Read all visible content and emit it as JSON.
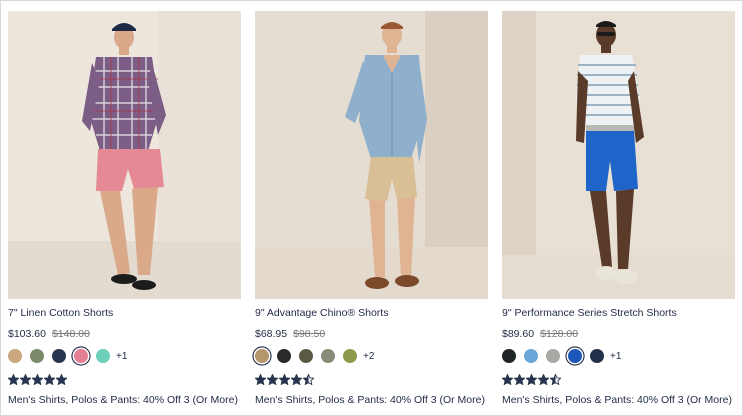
{
  "products": [
    {
      "title": "7\" Linen Cotton Shorts",
      "sale_price": "$103.60",
      "original_price": "$148.00",
      "swatches": [
        {
          "color": "#caa77c",
          "selected": false
        },
        {
          "color": "#7d8a6a",
          "selected": false
        },
        {
          "color": "#27344d",
          "selected": false
        },
        {
          "color": "#e27f93",
          "selected": true
        },
        {
          "color": "#6ed0b8",
          "selected": false
        }
      ],
      "more_colors": "+1",
      "rating": 5,
      "promo": "Men's Shirts, Polos & Pants: 40% Off 3 (Or More)"
    },
    {
      "title": "9\" Advantage Chino® Shorts",
      "sale_price": "$68.95",
      "original_price": "$98.50",
      "swatches": [
        {
          "color": "#b4976c",
          "selected": true
        },
        {
          "color": "#2a2a2a",
          "selected": false
        },
        {
          "color": "#5a5a44",
          "selected": false
        },
        {
          "color": "#8a8a78",
          "selected": false
        },
        {
          "color": "#8c9a4c",
          "selected": false
        }
      ],
      "more_colors": "+2",
      "rating": 4.5,
      "promo": "Men's Shirts, Polos & Pants: 40% Off 3 (Or More)"
    },
    {
      "title": "9\" Performance Series Stretch Shorts",
      "sale_price": "$89.60",
      "original_price": "$128.00",
      "swatches": [
        {
          "color": "#1f2426",
          "selected": false
        },
        {
          "color": "#6aa6d8",
          "selected": false
        },
        {
          "color": "#a9a9a4",
          "selected": false
        },
        {
          "color": "#1d58b8",
          "selected": true
        },
        {
          "color": "#22304a",
          "selected": false
        }
      ],
      "more_colors": "+1",
      "rating": 4.5,
      "promo": "Men's Shirts, Polos & Pants: 40% Off 3 (Or More)"
    }
  ],
  "icons": {
    "star": "star-icon",
    "half_star": "star-half-icon"
  },
  "colors": {
    "text": "#1f2a44",
    "strike_price": "#7a7a7a",
    "star": "#27344d"
  }
}
